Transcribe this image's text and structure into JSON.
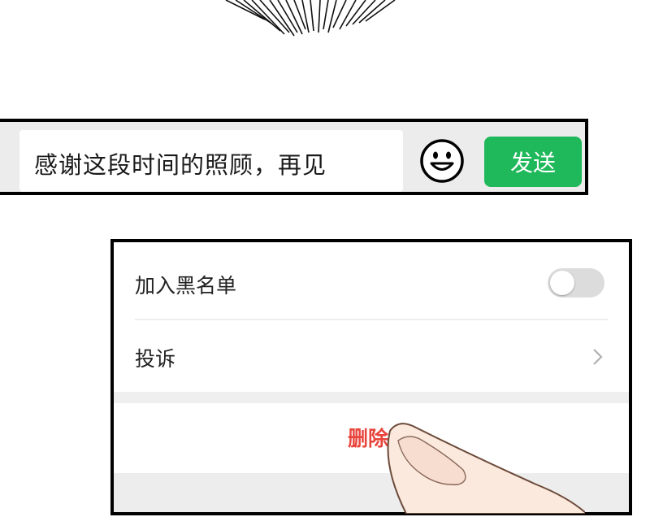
{
  "chat_bar": {
    "input_text": "感谢这段时间的照顾，再见",
    "emoji_icon": "smiley-face-icon",
    "send_label": "发送",
    "send_color": "#1fb85a"
  },
  "settings": {
    "blacklist_label": "加入黑名单",
    "blacklist_enabled": false,
    "complain_label": "投诉",
    "complain_icon": "chevron-right-icon",
    "delete_label": "删除",
    "delete_color": "#e8453c"
  }
}
